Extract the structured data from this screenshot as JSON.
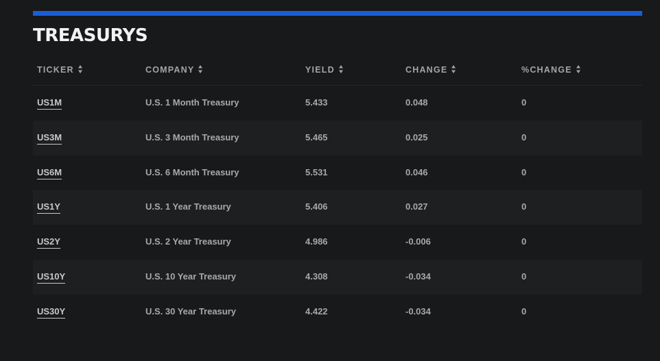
{
  "section": {
    "title": "TREASURYS",
    "accent_color": "#1a5ed6"
  },
  "table": {
    "columns": [
      {
        "label": "TICKER",
        "icon": "sort-icon"
      },
      {
        "label": "COMPANY",
        "icon": "sort-icon"
      },
      {
        "label": "YIELD",
        "icon": "sort-icon"
      },
      {
        "label": "CHANGE",
        "icon": "sort-icon"
      },
      {
        "label": "%CHANGE",
        "icon": "sort-icon"
      }
    ],
    "rows": [
      {
        "ticker": "US1M",
        "company": "U.S. 1 Month Treasury",
        "yield": "5.433",
        "change": "0.048",
        "pct_change": "0"
      },
      {
        "ticker": "US3M",
        "company": "U.S. 3 Month Treasury",
        "yield": "5.465",
        "change": "0.025",
        "pct_change": "0"
      },
      {
        "ticker": "US6M",
        "company": "U.S. 6 Month Treasury",
        "yield": "5.531",
        "change": "0.046",
        "pct_change": "0"
      },
      {
        "ticker": "US1Y",
        "company": "U.S. 1 Year Treasury",
        "yield": "5.406",
        "change": "0.027",
        "pct_change": "0"
      },
      {
        "ticker": "US2Y",
        "company": "U.S. 2 Year Treasury",
        "yield": "4.986",
        "change": "-0.006",
        "pct_change": "0"
      },
      {
        "ticker": "US10Y",
        "company": "U.S. 10 Year Treasury",
        "yield": "4.308",
        "change": "-0.034",
        "pct_change": "0"
      },
      {
        "ticker": "US30Y",
        "company": "U.S. 30 Year Treasury",
        "yield": "4.422",
        "change": "-0.034",
        "pct_change": "0"
      }
    ]
  }
}
